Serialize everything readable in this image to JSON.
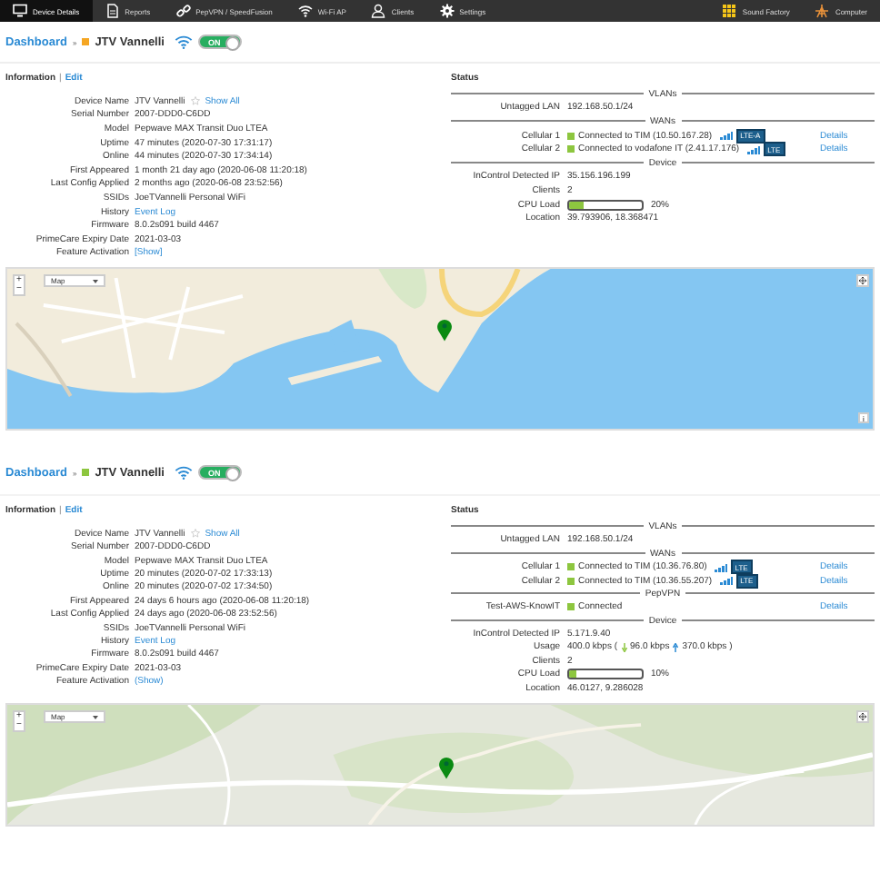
{
  "nav": {
    "items": [
      {
        "label": "Device Details",
        "selected": true
      },
      {
        "label": "Reports",
        "selected": false
      },
      {
        "label": "PepVPN / SpeedFusion",
        "selected": false
      },
      {
        "label": "Wi-Fi AP",
        "selected": false
      },
      {
        "label": "Clients",
        "selected": false
      },
      {
        "label": "Settings",
        "selected": false
      }
    ],
    "right": [
      {
        "label": "Sound Factory"
      },
      {
        "label": "Computer"
      }
    ]
  },
  "dashboards": [
    {
      "breadcrumb": {
        "link": "Dashboard",
        "separator": "»",
        "color": "#f5a623",
        "device": "JTV Vannelli"
      },
      "wifi_toggle": {
        "label": "ON",
        "on": true
      },
      "information": {
        "title": "Information",
        "separator": "|",
        "edit": "Edit",
        "rows": [
          {
            "label": "Device Name",
            "value": "JTV Vannelli",
            "starred": false,
            "link": "Show All"
          },
          {
            "label": "Serial Number",
            "value": "2007-DDD0-C6DD"
          },
          {
            "label": "Model",
            "value": "Pepwave MAX Transit Duo LTEA"
          },
          {
            "label": "Uptime",
            "value": "47 minutes (2020-07-30 17:31:17)"
          },
          {
            "label": "Online",
            "value": "44 minutes (2020-07-30 17:34:14)"
          },
          {
            "label": "First Appeared",
            "value": "1 month 21 day ago (2020-06-08 11:20:18)"
          },
          {
            "label": "Last Config Applied",
            "value": "2 months ago (2020-06-08 23:52:56)"
          },
          {
            "label": "SSIDs",
            "value": "JoeTVannelli Personal WiFi"
          },
          {
            "label": "History",
            "link": "Event Log"
          },
          {
            "label": "Firmware",
            "value": "8.0.2s091 build 4467"
          },
          {
            "label": "PrimeCare Expiry Date",
            "value": "2021-03-03"
          },
          {
            "label": "Feature Activation",
            "link": "[Show]"
          }
        ]
      },
      "status": {
        "title": "Status",
        "sections": [
          {
            "heading": "VLANs",
            "rows": [
              {
                "kind": "text",
                "label": "Untagged LAN",
                "value": "192.168.50.1/24"
              }
            ]
          },
          {
            "heading": "WANs",
            "rows": [
              {
                "kind": "connection",
                "label": "Cellular 1",
                "connected": true,
                "value": "Connected to TIM (10.50.167.28)",
                "badge": "LTE-A",
                "details": "Details"
              },
              {
                "kind": "connection",
                "label": "Cellular 2",
                "connected": true,
                "value": "Connected to vodafone IT (2.41.17.176)",
                "badge": "LTE",
                "details": "Details"
              }
            ]
          },
          {
            "heading": "Device",
            "rows": [
              {
                "kind": "text",
                "label": "InControl Detected IP",
                "value": "35.156.196.199"
              },
              {
                "kind": "text",
                "label": "Clients",
                "value": "2"
              },
              {
                "kind": "meter",
                "label": "CPU Load",
                "level": 0.2,
                "reading": "20%"
              },
              {
                "kind": "text",
                "label": "Location",
                "value": "39.793906, 18.368471"
              }
            ]
          }
        ]
      },
      "map": {
        "zoom_in": "+",
        "zoom_out": "−",
        "type": "Map",
        "attribution": "i"
      }
    },
    {
      "breadcrumb": {
        "link": "Dashboard",
        "separator": "»",
        "color": "#8dc63f",
        "device": "JTV Vannelli"
      },
      "wifi_toggle": {
        "label": "ON",
        "on": true
      },
      "information": {
        "title": "Information",
        "separator": "|",
        "edit": "Edit",
        "rows": [
          {
            "label": "Device Name",
            "value": "JTV Vannelli",
            "starred": false,
            "link": "Show All"
          },
          {
            "label": "Serial Number",
            "value": "2007-DDD0-C6DD"
          },
          {
            "label": "Model",
            "value": "Pepwave MAX Transit Duo LTEA"
          },
          {
            "label": "Uptime",
            "value": "20 minutes (2020-07-02 17:33:13)"
          },
          {
            "label": "Online",
            "value": "20 minutes (2020-07-02 17:34:50)"
          },
          {
            "label": "First Appeared",
            "value": "24 days 6 hours ago (2020-06-08 11:20:18)"
          },
          {
            "label": "Last Config Applied",
            "value": "24 days ago (2020-06-08 23:52:56)"
          },
          {
            "label": "SSIDs",
            "value": "JoeTVannelli Personal WiFi"
          },
          {
            "label": "History",
            "link": "Event Log"
          },
          {
            "label": "Firmware",
            "value": "8.0.2s091 build 4467"
          },
          {
            "label": "PrimeCare Expiry Date",
            "value": "2021-03-03"
          },
          {
            "label": "Feature Activation",
            "link": "(Show)"
          }
        ]
      },
      "status": {
        "title": "Status",
        "sections": [
          {
            "heading": "VLANs",
            "rows": [
              {
                "kind": "text",
                "label": "Untagged LAN",
                "value": "192.168.50.1/24"
              }
            ]
          },
          {
            "heading": "WANs",
            "rows": [
              {
                "kind": "connection",
                "label": "Cellular 1",
                "connected": true,
                "value": "Connected to TIM (10.36.76.80)",
                "badge": "LTE",
                "details": "Details"
              },
              {
                "kind": "connection",
                "label": "Cellular 2",
                "connected": true,
                "value": "Connected to TIM (10.36.55.207)",
                "badge": "LTE",
                "details": "Details"
              }
            ]
          },
          {
            "heading": "PepVPN",
            "rows": [
              {
                "kind": "connection",
                "label": "Test-AWS-KnowIT",
                "connected": true,
                "value": "Connected",
                "details": "Details"
              }
            ]
          },
          {
            "heading": "Device",
            "rows": [
              {
                "kind": "text",
                "label": "InControl Detected IP",
                "value": "5.171.9.40"
              },
              {
                "kind": "usage",
                "label": "Usage",
                "total": "400.0 kbps (",
                "down": "96.0 kbps",
                "up": "370.0 kbps )"
              },
              {
                "kind": "text",
                "label": "Clients",
                "value": "2"
              },
              {
                "kind": "meter",
                "label": "CPU Load",
                "level": 0.1,
                "reading": "10%"
              },
              {
                "kind": "text",
                "label": "Location",
                "value": "46.0127, 9.286028"
              }
            ]
          }
        ]
      },
      "map": {
        "zoom_in": "+",
        "zoom_out": "−",
        "type": "Map"
      }
    }
  ]
}
